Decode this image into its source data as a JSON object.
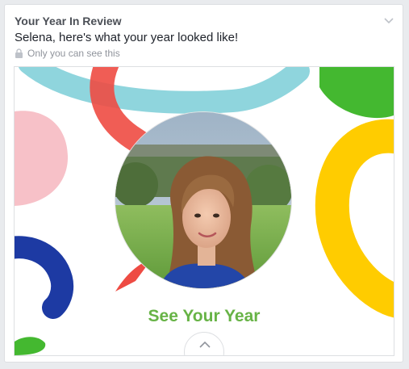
{
  "post": {
    "title": "Your Year In Review",
    "subtitle": "Selena, here's what your year looked like!",
    "privacy_text": "Only you can see this",
    "cta_label": "See Your Year"
  },
  "icons": {
    "menu": "chevron-down-icon",
    "privacy": "lock-icon",
    "expand": "chevron-up-icon"
  },
  "colors": {
    "cta_green": "#67b346",
    "brush_cyan": "#8fd5dd",
    "brush_red": "#ee4b43",
    "brush_pink": "#f7c1c8",
    "brush_green": "#44b830",
    "brush_yellow": "#ffcc00",
    "brush_blue": "#1d3aa3"
  }
}
